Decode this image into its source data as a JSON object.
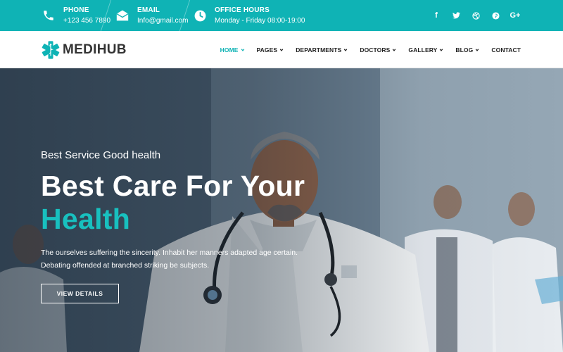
{
  "topbar": {
    "phone": {
      "label": "PHONE",
      "value": "+123 456 7890",
      "icon": "phone-icon"
    },
    "email": {
      "label": "EMAIL",
      "value": "Info@gmail.com",
      "icon": "envelope-icon"
    },
    "hours": {
      "label": "OFFICE HOURS",
      "value": "Monday - Friday 08:00-19:00",
      "icon": "clock-icon"
    },
    "social": [
      {
        "glyph": "f",
        "icon": "facebook-icon"
      },
      {
        "glyph": "t",
        "icon": "twitter-icon"
      },
      {
        "glyph": "◎",
        "icon": "dribbble-icon"
      },
      {
        "glyph": "p",
        "icon": "pinterest-icon"
      },
      {
        "glyph": "G+",
        "icon": "google-plus-icon"
      }
    ]
  },
  "brand": {
    "name": "MEDIHUB",
    "icon": "medical-star-icon"
  },
  "nav": {
    "items": [
      {
        "label": "HOME",
        "active": true,
        "dropdown": true
      },
      {
        "label": "PAGES",
        "active": false,
        "dropdown": true
      },
      {
        "label": "DEPARTMENTS",
        "active": false,
        "dropdown": true
      },
      {
        "label": "DOCTORS",
        "active": false,
        "dropdown": true
      },
      {
        "label": "GALLERY",
        "active": false,
        "dropdown": true
      },
      {
        "label": "BLOG",
        "active": false,
        "dropdown": true
      },
      {
        "label": "CONTACT",
        "active": false,
        "dropdown": false
      }
    ]
  },
  "hero": {
    "subtitle": "Best Service Good health",
    "title_line1": "Best Care For Your",
    "title_line2": "Health",
    "description_line1": "The ourselves suffering the sincerity. Inhabit her manners adapted age certain.",
    "description_line2": "Debating offended at branched striking be subjects.",
    "button_label": "VIEW DETAILS"
  },
  "colors": {
    "accent": "#0fb3b5",
    "accent_text": "#18c0bf",
    "topbar_bg": "#0fb3b5",
    "nav_text": "#222222"
  }
}
